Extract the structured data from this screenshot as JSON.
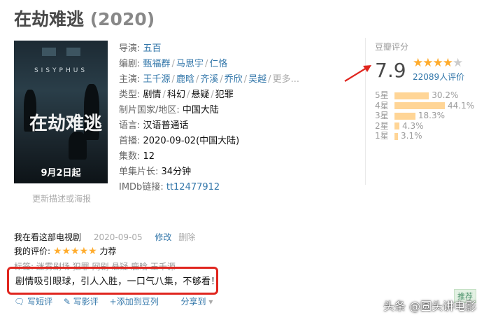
{
  "title": {
    "name": "在劫难逃",
    "year": "(2020)"
  },
  "poster": {
    "top_text": "SISYPHUS",
    "title_text": "在劫难逃",
    "release_text": "9月2日起",
    "more_link": "更新描述或海报"
  },
  "info": {
    "director_key": "导演:",
    "director": "五百",
    "writer_key": "编剧:",
    "writers": [
      "甄福群",
      "马思宇",
      "仁恪"
    ],
    "cast_key": "主演:",
    "cast": [
      "王千源",
      "鹿晗",
      "齐溪",
      "乔欣",
      "吴越"
    ],
    "cast_more": "更多...",
    "genre_key": "类型:",
    "genres": [
      "剧情",
      "科幻",
      "悬疑",
      "犯罪"
    ],
    "country_key": "制片国家/地区:",
    "country": "中国大陆",
    "language_key": "语言:",
    "language": "汉语普通话",
    "premiere_key": "首播:",
    "premiere": "2020-09-02(中国大陆)",
    "episodes_key": "集数:",
    "episodes": "12",
    "runtime_key": "单集片长:",
    "runtime": "34分钟",
    "imdb_key": "IMDb链接:",
    "imdb": "tt12477912"
  },
  "rating": {
    "title": "豆瓣评分",
    "score": "7.9",
    "stars": 4,
    "votes": "22089人评价",
    "distribution": [
      {
        "label": "5星",
        "percent": "30.2%",
        "value": 30.2
      },
      {
        "label": "4星",
        "percent": "44.1%",
        "value": 44.1
      },
      {
        "label": "3星",
        "percent": "18.3%",
        "value": 18.3
      },
      {
        "label": "2星",
        "percent": "4.3%",
        "value": 4.3
      },
      {
        "label": "1星",
        "percent": "3.1%",
        "value": 3.1
      }
    ],
    "star_color": "#ffac2d",
    "bar_color": "#ffd596"
  },
  "my_review": {
    "status": "我在看这部电视剧",
    "date": "2020-09-05",
    "edit": "修改",
    "delete": "删除",
    "my_rating_label": "我的评价:",
    "my_stars": 5,
    "my_rating_text": "力荐",
    "tags_text": "标签: 迷雾剧场 犯罪 网剧 悬疑 鹿晗 王千源",
    "comment": "剧情吸引眼球，引人入胜，一口气八集，不够看！",
    "highlight_color": "#e0261f"
  },
  "actions": {
    "write_short": "写短评",
    "write_review": "写影评",
    "add_doulist": "+添加到豆列",
    "share": "分享到",
    "recommend": "推荐"
  },
  "watermark": "头条 @圆头讲电影"
}
